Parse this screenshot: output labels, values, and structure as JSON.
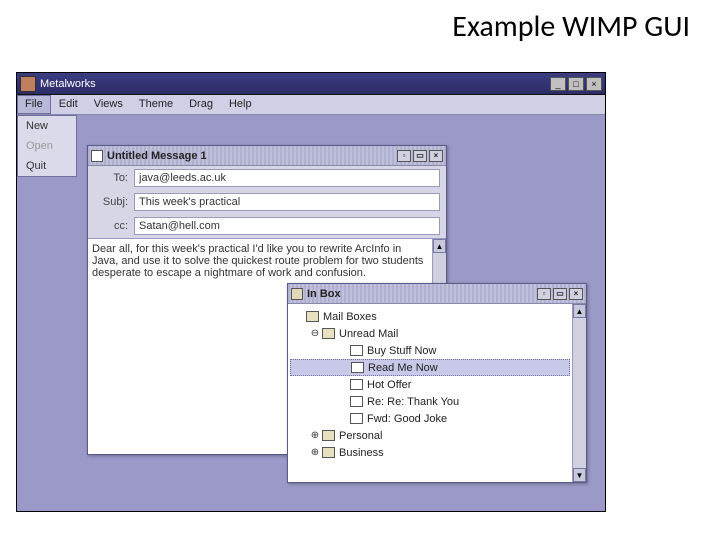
{
  "slide_title": "Example WIMP GUI",
  "app": {
    "title": "Metalworks",
    "menubar": [
      "File",
      "Edit",
      "Views",
      "Theme",
      "Drag",
      "Help"
    ],
    "file_menu": {
      "new": "New",
      "open": "Open",
      "quit": "Quit"
    }
  },
  "compose": {
    "title": "Untitled Message 1",
    "labels": {
      "to": "To:",
      "subj": "Subj:",
      "cc": "cc:"
    },
    "to": "java@leeds.ac.uk",
    "subj": "This week's practical",
    "cc": "Satan@hell.com",
    "body": "Dear all, for this week's practical I'd like you to rewrite ArcInfo in Java, and use it to solve the quickest route problem for two students desperate to escape a nightmare of work and confusion."
  },
  "inbox": {
    "title": "In Box",
    "items": [
      {
        "label": "Mail Boxes",
        "type": "folder",
        "level": 0,
        "expander": ""
      },
      {
        "label": "Unread Mail",
        "type": "folder",
        "level": 1,
        "expander": "⊖"
      },
      {
        "label": "Buy Stuff Now",
        "type": "doc",
        "level": 2,
        "expander": ""
      },
      {
        "label": "Read Me Now",
        "type": "doc",
        "level": 2,
        "expander": "",
        "selected": true
      },
      {
        "label": "Hot Offer",
        "type": "doc",
        "level": 2,
        "expander": ""
      },
      {
        "label": "Re: Re: Thank You",
        "type": "doc",
        "level": 2,
        "expander": ""
      },
      {
        "label": "Fwd: Good Joke",
        "type": "doc",
        "level": 2,
        "expander": ""
      },
      {
        "label": "Personal",
        "type": "folder",
        "level": 1,
        "expander": "⊕"
      },
      {
        "label": "Business",
        "type": "folder",
        "level": 1,
        "expander": "⊕"
      }
    ]
  }
}
